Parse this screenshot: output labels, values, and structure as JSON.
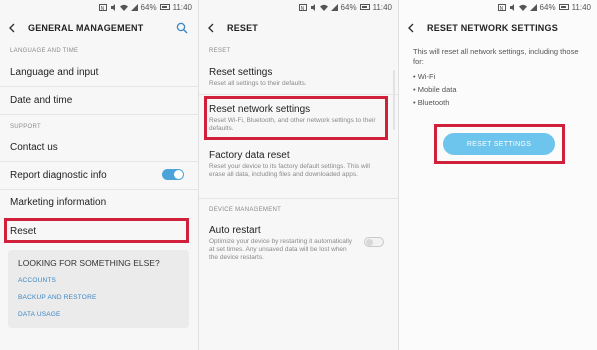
{
  "status": {
    "time": "11:40",
    "battery": "64%"
  },
  "panel1": {
    "title": "GENERAL MANAGEMENT",
    "section_language": "LANGUAGE AND TIME",
    "language_input": "Language and input",
    "date_time": "Date and time",
    "section_support": "SUPPORT",
    "contact_us": "Contact us",
    "report_diagnostic": "Report diagnostic info",
    "marketing_info": "Marketing information",
    "reset": "Reset",
    "card": {
      "title": "LOOKING FOR SOMETHING ELSE?",
      "links": [
        "ACCOUNTS",
        "BACKUP AND RESTORE",
        "DATA USAGE"
      ]
    }
  },
  "panel2": {
    "title": "RESET",
    "section_reset": "RESET",
    "reset_settings": "Reset settings",
    "reset_settings_sub": "Reset all settings to their defaults.",
    "reset_network": "Reset network settings",
    "reset_network_sub": "Reset Wi-Fi, Bluetooth, and other network settings to their defaults.",
    "factory_reset": "Factory data reset",
    "factory_reset_sub": "Reset your device to its factory default settings. This will erase all data, including files and downloaded apps.",
    "section_device": "DEVICE MANAGEMENT",
    "auto_restart": "Auto restart",
    "auto_restart_sub": "Optimize your device by restarting it automatically at set times. Any unsaved data will be lost when the device restarts."
  },
  "panel3": {
    "title": "RESET NETWORK SETTINGS",
    "info": "This will reset all network settings, including those for:",
    "bullets": [
      "Wi-Fi",
      "Mobile data",
      "Bluetooth"
    ],
    "button": "RESET SETTINGS"
  },
  "colors": {
    "highlight": "#d0203a",
    "accent": "#4aa3d9",
    "button": "#6dc4ec",
    "link": "#3a86c4"
  }
}
